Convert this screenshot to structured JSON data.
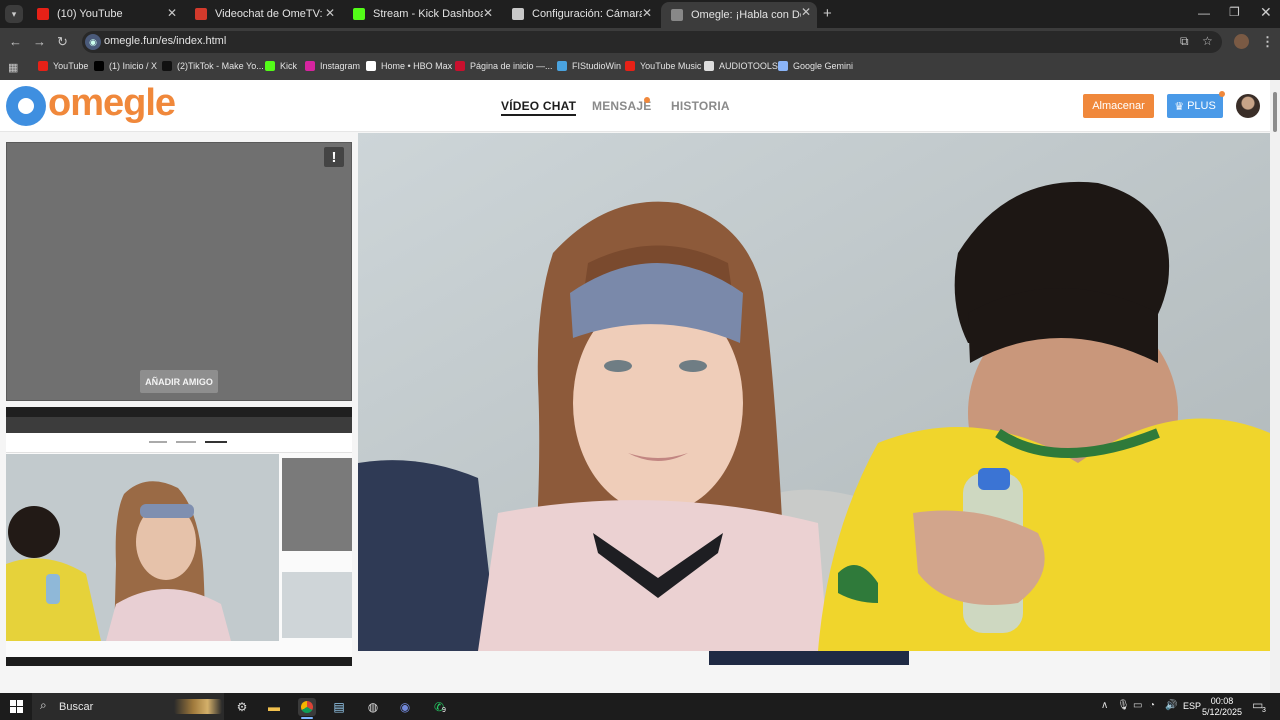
{
  "tabs": [
    {
      "title": "(10) YouTube",
      "icon": "youtube-icon",
      "color": "#e62117"
    },
    {
      "title": "Videochat de OmeTV: una alter",
      "icon": "ometv-icon",
      "color": "#d33a2c"
    },
    {
      "title": "Stream - Kick Dashboard",
      "icon": "kick-icon",
      "color": "#53fc18"
    },
    {
      "title": "Configuración: Cámara",
      "icon": "gear-icon",
      "color": "#c8c8c8"
    },
    {
      "title": "Omegle: ¡Habla con Descon",
      "icon": "omegle-icon",
      "color": "#888888"
    }
  ],
  "address": {
    "url": "omegle.fun/es/index.html"
  },
  "bookmarks": [
    {
      "label": "YouTube",
      "color": "#e62117"
    },
    {
      "label": "(1) Inicio / X",
      "color": "#000000"
    },
    {
      "label": "(2)TikTok - Make Yo...",
      "color": "#111111"
    },
    {
      "label": "Kick",
      "color": "#53fc18"
    },
    {
      "label": "Instagram",
      "color": "#d6249f"
    },
    {
      "label": "Home • HBO Max",
      "color": "#ffffff"
    },
    {
      "label": "Página de inicio —...",
      "color": "#c8102e"
    },
    {
      "label": "FIStudioWin",
      "color": "#4aa3df"
    },
    {
      "label": "YouTube Music",
      "color": "#e62117"
    },
    {
      "label": "AUDIOTOOLS",
      "color": "#dddddd"
    },
    {
      "label": "Google Gemini",
      "color": "#8ab4f8"
    }
  ],
  "site": {
    "logo": "omegle",
    "nav": [
      "VÍDEO CHAT",
      "MENSAJE",
      "HISTORIA"
    ],
    "store_button": "Almacenar",
    "plus_button": "PLUS",
    "add_friend": "AÑADIR AMIGO",
    "report_glyph": "!"
  },
  "taskbar": {
    "search": "Buscar",
    "language": "ESP",
    "time": "00:08",
    "date": "5/12/2025",
    "notifications": "3",
    "whatsapp_badge": "9"
  },
  "colors": {
    "brand_orange": "#f0883b",
    "brand_blue": "#3f8fe0",
    "plus_blue": "#4a9ae8"
  }
}
